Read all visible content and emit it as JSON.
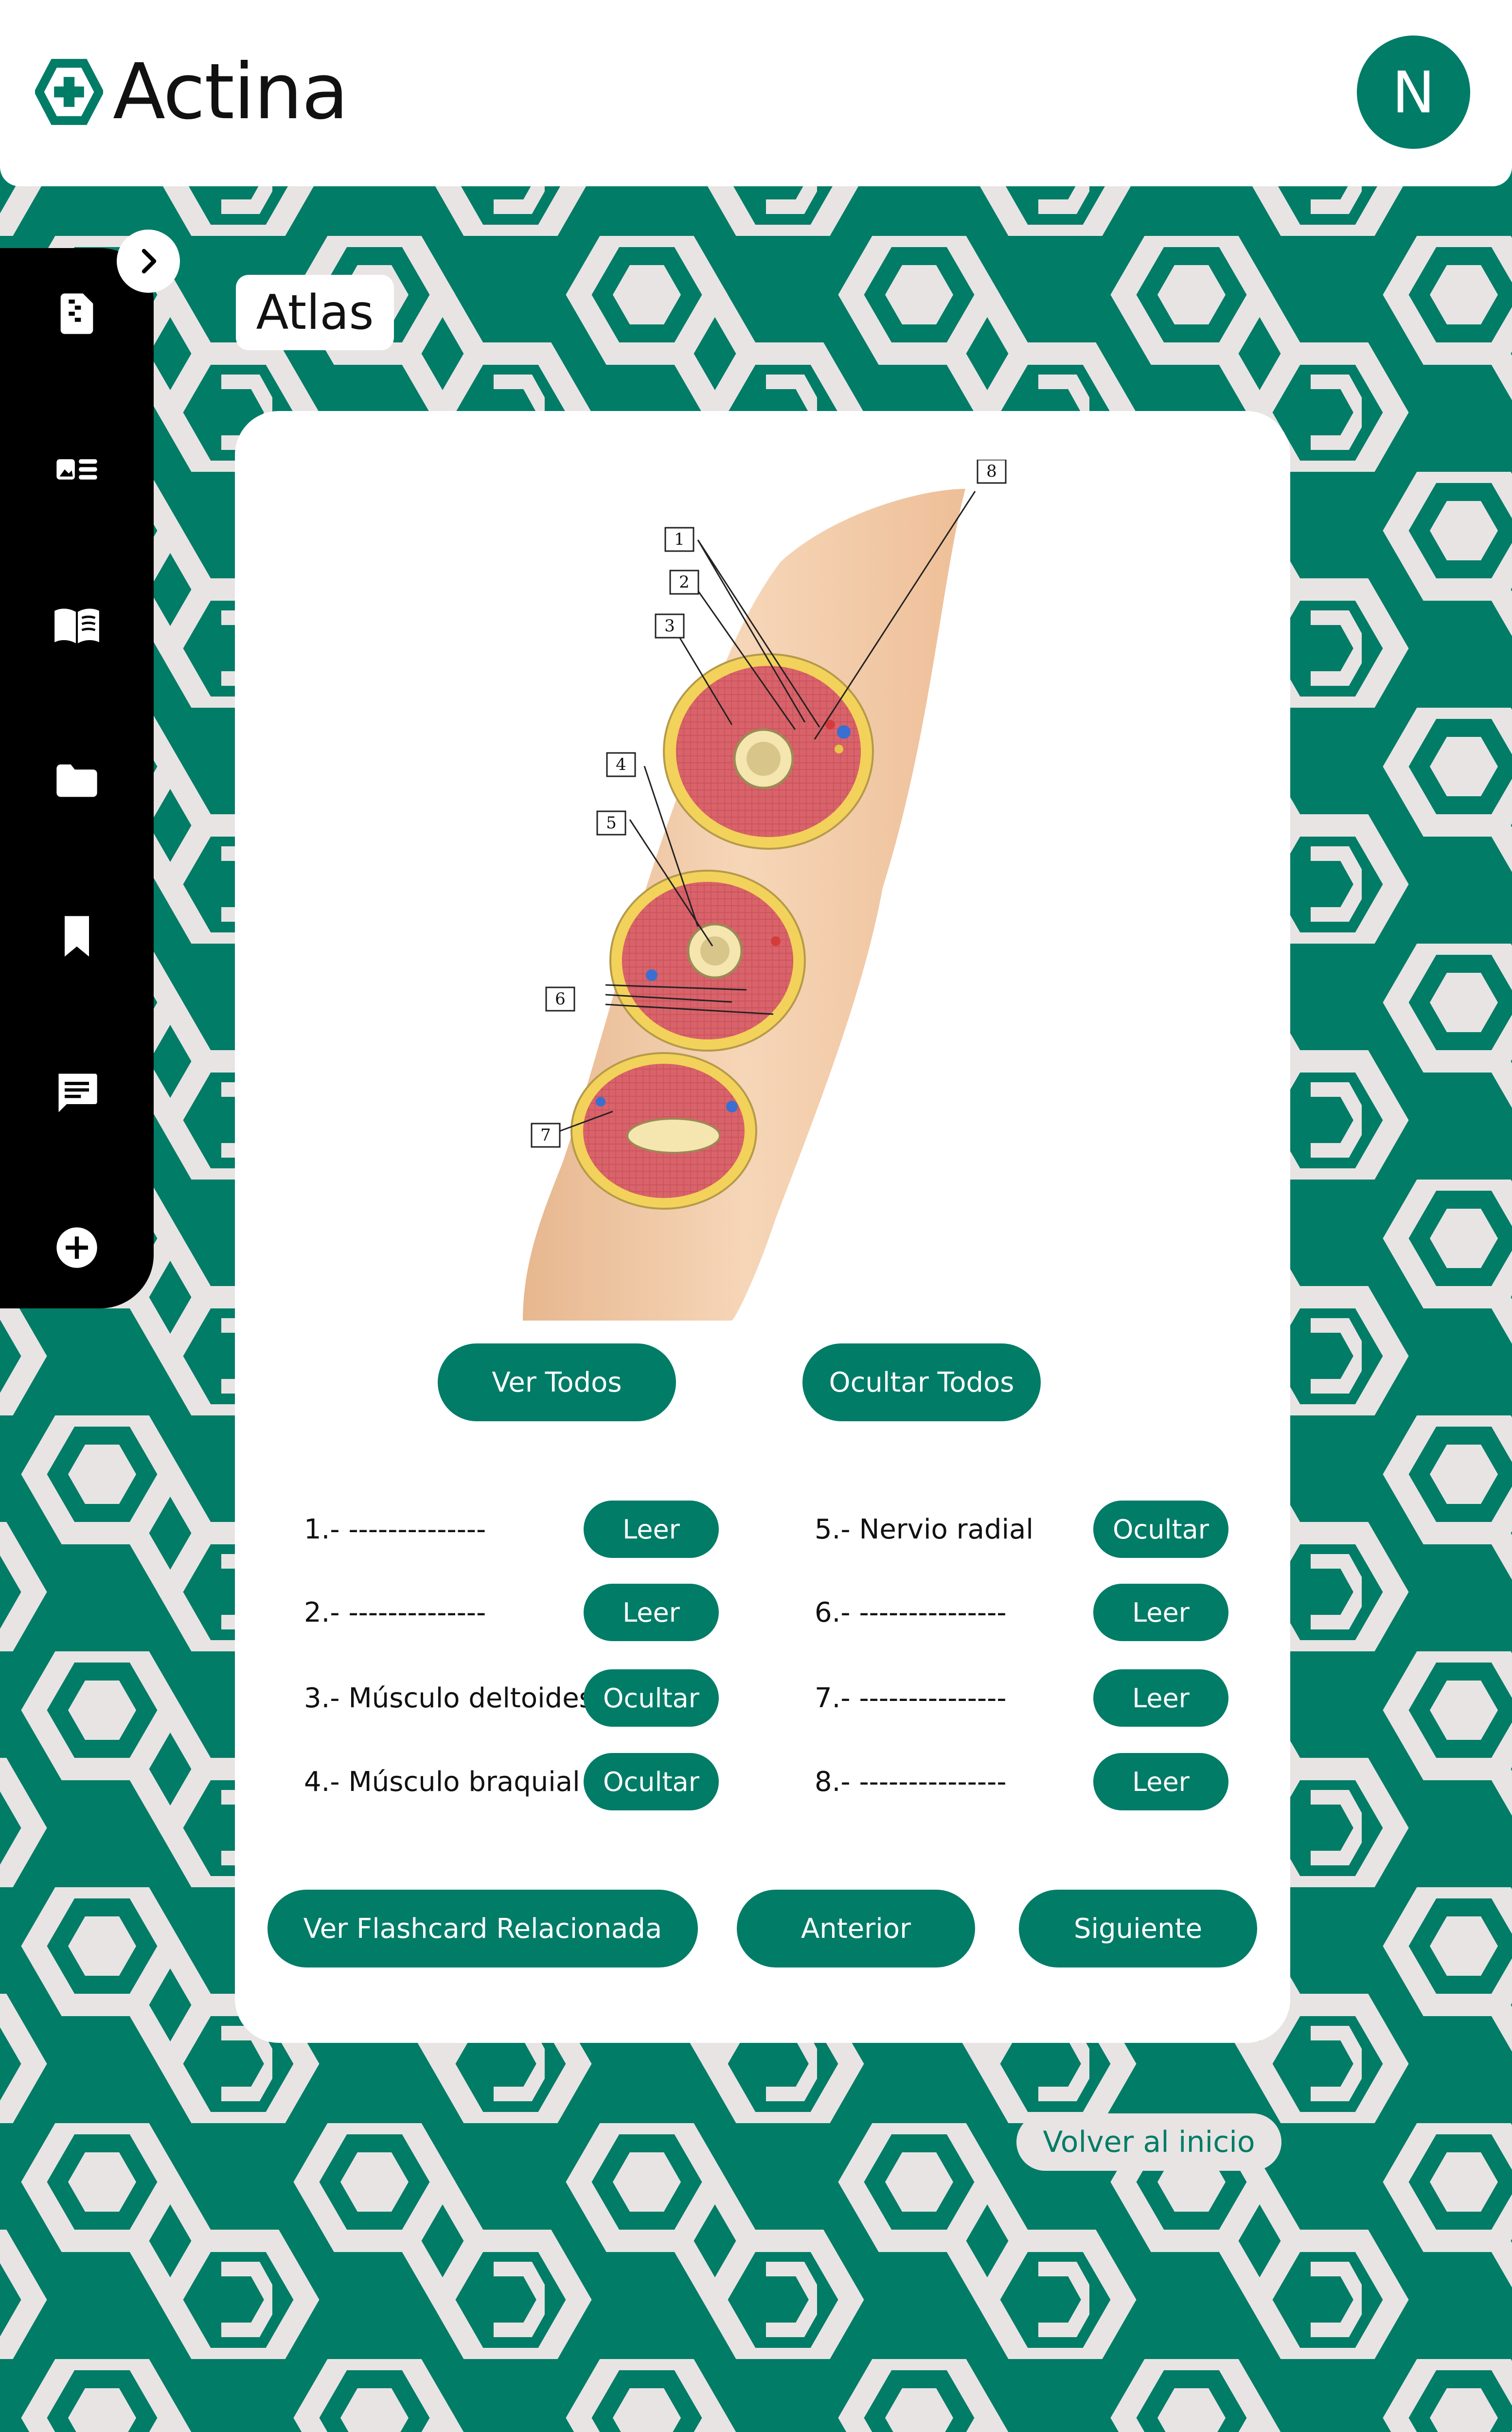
{
  "app": {
    "name": "Actina"
  },
  "user": {
    "initial": "N"
  },
  "page": {
    "title": "Atlas"
  },
  "sidebar": {
    "items": [
      {
        "icon": "document-icon"
      },
      {
        "icon": "image-list-icon"
      },
      {
        "icon": "book-icon"
      },
      {
        "icon": "folder-icon"
      },
      {
        "icon": "bookmark-icon"
      },
      {
        "icon": "chat-icon"
      },
      {
        "icon": "add-circle-icon"
      }
    ]
  },
  "figure": {
    "callouts": [
      "1",
      "2",
      "3",
      "4",
      "5",
      "6",
      "7",
      "8"
    ]
  },
  "controls": {
    "show_all": "Ver Todos",
    "hide_all": "Ocultar Todos"
  },
  "labels": [
    {
      "text": "1.- --------------",
      "action": "Leer"
    },
    {
      "text": "2.- --------------",
      "action": "Leer"
    },
    {
      "text": "3.- Músculo deltoides",
      "action": "Ocultar"
    },
    {
      "text": "4.- Músculo braquial",
      "action": "Ocultar"
    },
    {
      "text": "5.- Nervio radial",
      "action": "Ocultar"
    },
    {
      "text": "6.- ---------------",
      "action": "Leer"
    },
    {
      "text": "7.- ---------------",
      "action": "Leer"
    },
    {
      "text": "8.- ---------------",
      "action": "Leer"
    }
  ],
  "navigation": {
    "related_flashcard": "Ver Flashcard Relacionada",
    "previous": "Anterior",
    "next": "Siguiente"
  },
  "footer": {
    "back_home": "Volver al inicio"
  },
  "colors": {
    "brand": "#017c67",
    "pattern_light": "#e8e4e3",
    "sidebar": "#000000"
  }
}
